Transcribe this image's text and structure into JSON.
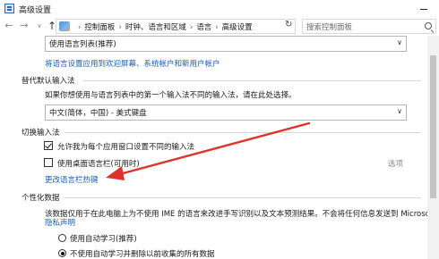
{
  "window": {
    "title": "高级设置"
  },
  "navbar": {
    "back_icon": "←",
    "forward_icon": "→",
    "recent_icon": "∨",
    "up_icon": "↑",
    "breadcrumbs": [
      "控制面板",
      "时钟、语言和区域",
      "语言",
      "高级设置"
    ],
    "breadcrumb_separator": "›",
    "refresh_icon": "↻",
    "search_placeholder": "搜索控制面板"
  },
  "display_language": {
    "selected": "使用语言列表(推荐)",
    "apply_link": "将语言设置应用到欢迎屏幕、系统帐户和新用户帐户"
  },
  "input_method_override": {
    "heading": "替代默认输入法",
    "description": "如果你想使用与语言列表中的第一个输入法不同的输入法，请在此处选择。",
    "selected": "中文(简体，中国) - 美式键盘"
  },
  "switch_input": {
    "heading": "切换输入法",
    "per_app_label": "允许我为每个应用窗口设置不同的输入法",
    "per_app_checked": true,
    "desktop_bar_label": "使用桌面语言栏(可用时)",
    "desktop_bar_checked": false,
    "options_label": "选项",
    "hotkeys_link": "更改语言栏热键"
  },
  "personalization": {
    "heading": "个性化数据",
    "description": "该数据仅用于在此电脑上为不使用 IME 的语言来改进手写识别以及文本预测结果。不会将任何信息发送到 Microsoft。",
    "privacy_link": "隐私声明",
    "option_auto_learn": "使用自动学习(推荐)",
    "option_auto_learn_selected": false,
    "option_no_auto_learn": "不使用自动学习并删除以前收集的所有数据",
    "option_no_auto_learn_selected": true
  },
  "colors": {
    "link": "#1a5fb4",
    "annotation_arrow": "#e0322b"
  }
}
